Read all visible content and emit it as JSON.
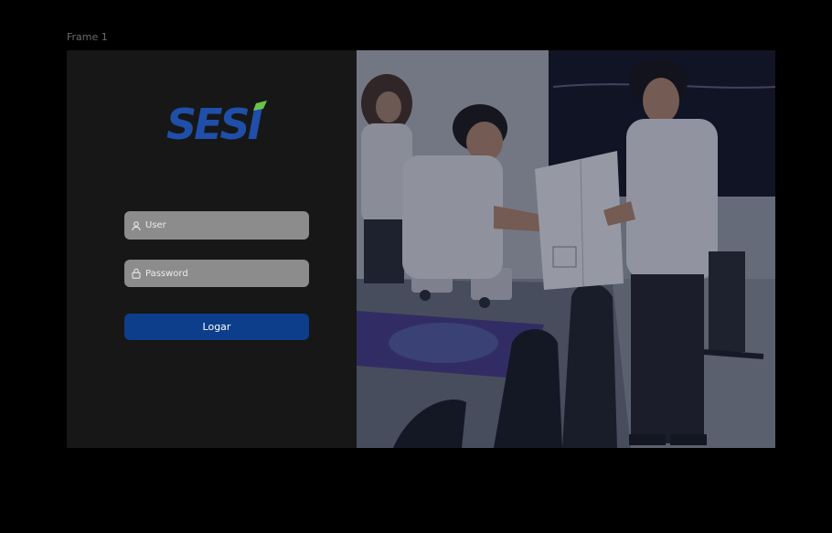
{
  "frame": {
    "label": "Frame 1"
  },
  "brand": {
    "logo_text": "SESI",
    "logo_color": "#1f4fa8",
    "accent_color": "#6cc24a"
  },
  "login": {
    "user_placeholder": "User",
    "password_placeholder": "Password",
    "submit_label": "Logar",
    "button_color": "#0d3e8c",
    "field_color": "#8c8c8c"
  },
  "icons": {
    "user": "user-icon",
    "password": "lock-icon"
  }
}
